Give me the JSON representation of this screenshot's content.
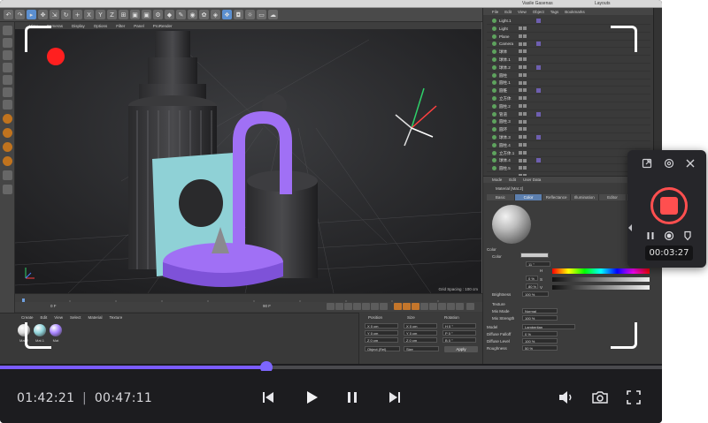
{
  "app": {
    "title": "Vasile Gasenas",
    "layout_label": "Layouts",
    "viewport_menu": [
      "View",
      "Cameras",
      "Display",
      "Options",
      "Filter",
      "Panel",
      "ProRender"
    ],
    "viewport_status": "Grid Spacing : 100 cm",
    "object_menu": [
      "File",
      "Edit",
      "View",
      "Object",
      "Tags",
      "Bookmarks"
    ],
    "objects": [
      "Light.1",
      "Light",
      "Plane",
      "Camera",
      "球体",
      "球体.1",
      "球体.2",
      "圆柱",
      "圆柱.1",
      "圆锥",
      "立方体",
      "圆柱.2",
      "管道",
      "圆柱.3",
      "圆环",
      "球体.3",
      "圆柱.4",
      "立方体.1",
      "球体.4",
      "圆柱.5"
    ],
    "attr_menu": [
      "Mode",
      "Edit",
      "User Data"
    ],
    "attr_object": "Material [Mat.2]",
    "attr_tabs": [
      "Basic",
      "Color",
      "Reflectance",
      "Illumination",
      "Editor",
      "Assign"
    ],
    "color_label": "Color",
    "color_field": "Color",
    "h_label": "H",
    "h_value": "11 °",
    "s_label": "S",
    "s_value": "0 %",
    "v_label": "V",
    "v_value": "80 %",
    "brightness_label": "Brightness",
    "brightness_value": "100 %",
    "texture_label": "Texture",
    "mix_mode_label": "Mix Mode",
    "mix_mode_value": "Normal",
    "mix_strength_label": "Mix Strength",
    "mix_strength_value": "100 %",
    "model_label": "Model",
    "model_value": "Lambertian",
    "diffuse_label": "Diffuse Falloff",
    "diffuse_value": "0 %",
    "diffuse_level_label": "Diffuse Level",
    "diffuse_level_value": "100 %",
    "roughness_label": "Roughness",
    "roughness_value": "50 %",
    "material_menu": [
      "Create",
      "Edit",
      "View",
      "Select",
      "Material",
      "Texture"
    ],
    "materials": [
      {
        "name": "Mat.2",
        "color": "#d9d9d9"
      },
      {
        "name": "Mat.1",
        "color": "#8fd3d9"
      },
      {
        "name": "Mat",
        "color": "#a783ff"
      }
    ],
    "coord_headers": [
      "Position",
      "Size",
      "Rotation"
    ],
    "coord_rows": [
      [
        "X 0 cm",
        "X 0 cm",
        "H 0 °"
      ],
      [
        "Y 0 cm",
        "Y 0 cm",
        "P 0 °"
      ],
      [
        "Z 0 cm",
        "Z 0 cm",
        "B 0 °"
      ]
    ],
    "coord_mode": "Object (Rel)",
    "coord_size_mode": "Size",
    "apply_label": "Apply",
    "frame_start": "0 F",
    "frame_end": "90 F"
  },
  "player": {
    "current_time": "01:42:21",
    "separator": "|",
    "total_time": "00:47:11",
    "progress_fraction": 0.402,
    "accent": "#7b5cff"
  },
  "recorder": {
    "timer": "00:03:27",
    "record_color": "#ff4f4f"
  },
  "icons": [
    "expand-icon",
    "settings-icon",
    "close-icon",
    "pause-icon",
    "screenshot-icon",
    "annotate-icon",
    "skip-back-icon",
    "play-icon",
    "skip-forward-icon",
    "volume-icon",
    "camera-icon",
    "fullscreen-icon"
  ]
}
